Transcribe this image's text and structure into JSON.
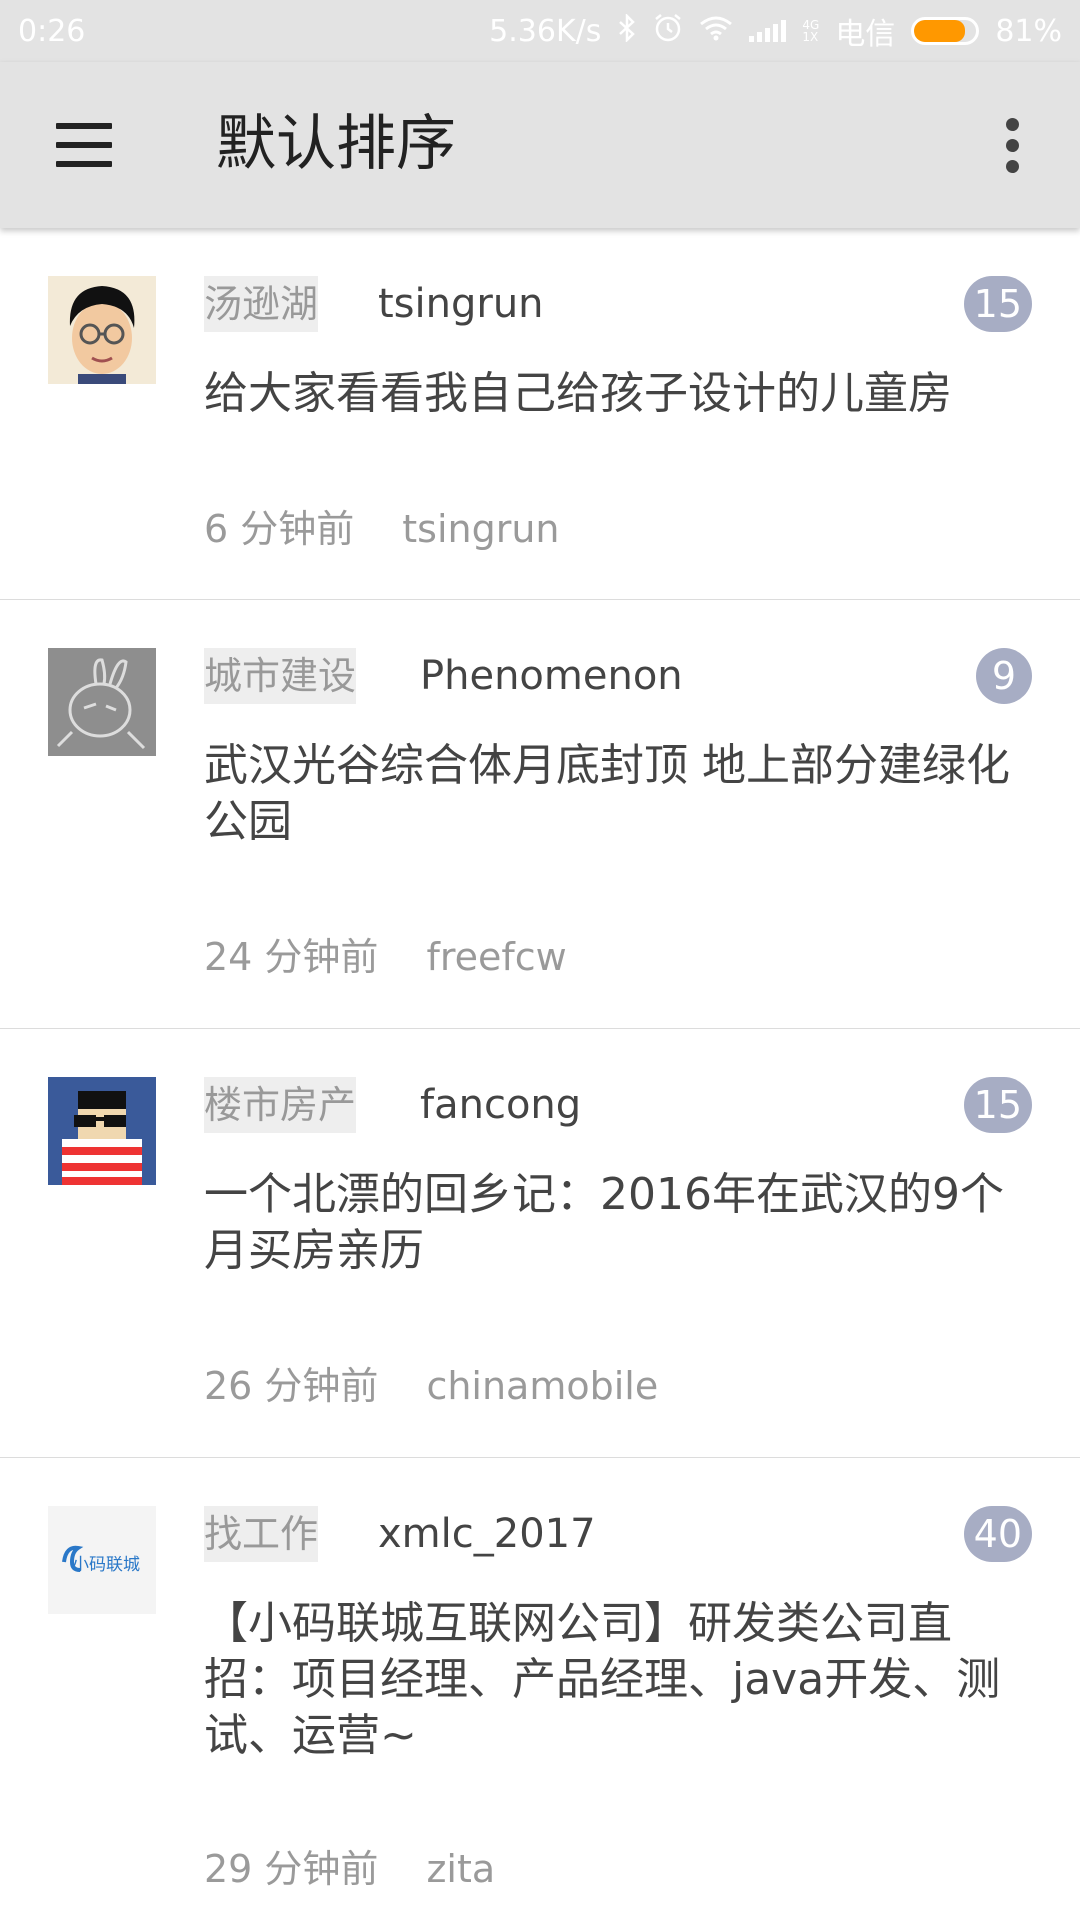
{
  "status_bar": {
    "time": "0:26",
    "net_speed": "5.36K/s",
    "network_type_top": "4G",
    "network_type_bottom": "1X",
    "carrier": "电信",
    "battery_percent_label": "81%",
    "battery_level": 0.81,
    "icons": [
      "bluetooth-icon",
      "alarm-icon",
      "wifi-icon",
      "signal-icon",
      "battery-icon"
    ]
  },
  "appbar": {
    "title": "默认排序",
    "icons": [
      "menu-icon",
      "more-vert-icon"
    ]
  },
  "colors": {
    "appbar_bg": "#e3e3e3",
    "badge_bg": "#a7adc4",
    "category_bg": "#eeeeee",
    "battery_fill": "#ff9800"
  },
  "posts": [
    {
      "category": "汤逊湖",
      "author": "tsingrun",
      "count": "15",
      "title": "给大家看看我自己给孩子设计的儿童房",
      "time": "6 分钟前",
      "last_reply": "tsingrun",
      "avatar": "cartoon-glasses-avatar"
    },
    {
      "category": "城市建设",
      "author": "Phenomenon",
      "count": "9",
      "title": "武汉光谷综合体月底封顶 地上部分建绿化公园",
      "time": "24 分钟前",
      "last_reply": "freefcw",
      "avatar": "rabbit-sketch-avatar"
    },
    {
      "category": "楼市房产",
      "author": "fancong",
      "count": "15",
      "title": "一个北漂的回乡记：2016年在武汉的9个月买房亲历",
      "time": "26 分钟前",
      "last_reply": "chinamobile",
      "avatar": "pixel-sunglasses-avatar"
    },
    {
      "category": "找工作",
      "author": "xmlc_2017",
      "count": "40",
      "title": "【小码联城互联网公司】研发类公司直招：项目经理、产品经理、java开发、测试、运营~",
      "time": "29 分钟前",
      "last_reply": "zita",
      "avatar": "xiaoma-lianchen-logo-avatar",
      "avatar_text": "小码联城"
    }
  ]
}
